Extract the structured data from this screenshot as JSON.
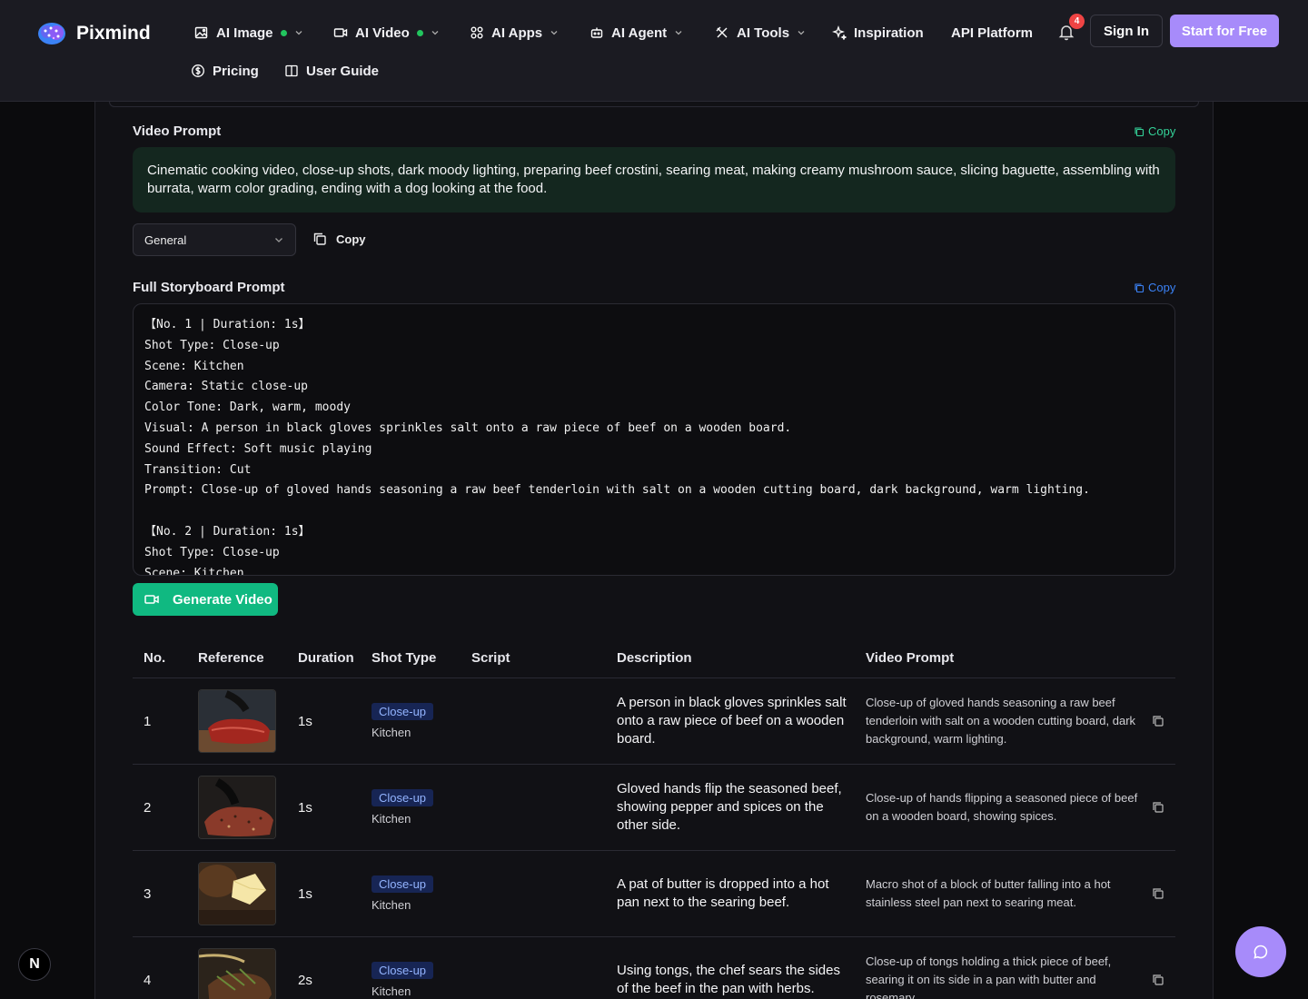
{
  "brand": {
    "name": "Pixmind",
    "accent": "#a78bfa",
    "green": "#10b981"
  },
  "nav": {
    "items": [
      {
        "label": "AI Image",
        "icon": "image-edit-icon",
        "dot": true,
        "chevron": true
      },
      {
        "label": "AI Video",
        "icon": "video-icon",
        "dot": true,
        "chevron": true
      },
      {
        "label": "AI Apps",
        "icon": "grid-icon",
        "dot": false,
        "chevron": true
      },
      {
        "label": "AI Agent",
        "icon": "robot-icon",
        "dot": false,
        "chevron": true
      },
      {
        "label": "AI Tools",
        "icon": "tools-icon",
        "dot": false,
        "chevron": true
      },
      {
        "label": "Inspiration",
        "icon": "sparkles-icon",
        "dot": false,
        "chevron": false
      },
      {
        "label": "API Platform",
        "icon": "",
        "dot": false,
        "chevron": false
      },
      {
        "label": "Pricing",
        "icon": "dollar-circle-icon",
        "dot": false,
        "chevron": false
      },
      {
        "label": "User Guide",
        "icon": "book-icon",
        "dot": false,
        "chevron": false
      }
    ],
    "notifications": "4",
    "sign_in": "Sign In",
    "start_free": "Start for Free"
  },
  "video_prompt": {
    "title": "Video Prompt",
    "copy": "Copy",
    "text": "Cinematic cooking video, close-up shots, dark moody lighting, preparing beef crostini, searing meat, making creamy mushroom sauce, slicing baguette, assembling with burrata, warm color grading, ending with a dog looking at the food."
  },
  "controls": {
    "select_value": "General",
    "copy": "Copy"
  },
  "storyboard": {
    "title": "Full Storyboard Prompt",
    "copy": "Copy",
    "lines": [
      "【No. 1 | Duration: 1s】",
      "Shot Type: Close-up",
      "Scene: Kitchen",
      "Camera: Static close-up",
      "Color Tone: Dark, warm, moody",
      "Visual: A person in black gloves sprinkles salt onto a raw piece of beef on a wooden board.",
      "Sound Effect: Soft music playing",
      "Transition: Cut",
      "Prompt: Close-up of gloved hands seasoning a raw beef tenderloin with salt on a wooden cutting board, dark background, warm lighting.",
      "",
      "【No. 2 | Duration: 1s】",
      "Shot Type: Close-up",
      "Scene: Kitchen"
    ]
  },
  "generate_button": "Generate Video",
  "table": {
    "headers": [
      "No.",
      "Reference",
      "Duration",
      "Shot Type",
      "Script",
      "Description",
      "Video Prompt"
    ],
    "rows": [
      {
        "no": "1",
        "duration": "1s",
        "shot": "Close-up",
        "scene": "Kitchen",
        "description": "A person in black gloves sprinkles salt onto a raw piece of beef on a wooden board.",
        "prompt": "Close-up of gloved hands seasoning a raw beef tenderloin with salt on a wooden cutting board, dark background, warm lighting."
      },
      {
        "no": "2",
        "duration": "1s",
        "shot": "Close-up",
        "scene": "Kitchen",
        "description": "Gloved hands flip the seasoned beef, showing pepper and spices on the other side.",
        "prompt": "Close-up of hands flipping a seasoned piece of beef on a wooden board, showing spices."
      },
      {
        "no": "3",
        "duration": "1s",
        "shot": "Close-up",
        "scene": "Kitchen",
        "description": "A pat of butter is dropped into a hot pan next to the searing beef.",
        "prompt": "Macro shot of a block of butter falling into a hot stainless steel pan next to searing meat."
      },
      {
        "no": "4",
        "duration": "2s",
        "shot": "Close-up",
        "scene": "Kitchen",
        "description": "Using tongs, the chef sears the sides of the beef in the pan with herbs.",
        "prompt": "Close-up of tongs holding a thick piece of beef, searing it on its side in a pan with butter and rosemary."
      }
    ]
  },
  "corner_badge": "N"
}
